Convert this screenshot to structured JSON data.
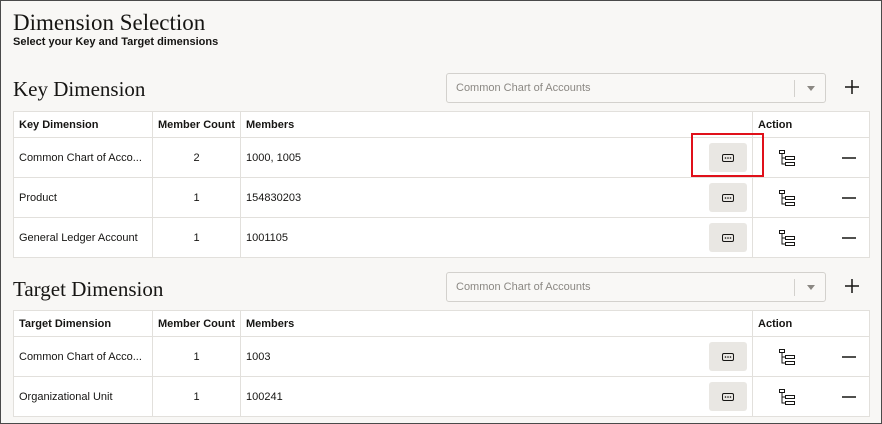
{
  "page": {
    "title": "Dimension Selection",
    "subtitle": "Select your Key and Target dimensions"
  },
  "key_section": {
    "title": "Key Dimension",
    "select_placeholder": "Common Chart of Accounts",
    "columns": [
      "Key Dimension",
      "Member Count",
      "Members",
      "Action"
    ],
    "rows": [
      {
        "name": "Common Chart of Accounts",
        "display_name": "Common Chart of Acco...",
        "count": "2",
        "members": "1000, 1005"
      },
      {
        "name": "Product",
        "display_name": "Product",
        "count": "1",
        "members": "154830203"
      },
      {
        "name": "General Ledger Account",
        "display_name": "General Ledger Account",
        "count": "1",
        "members": "1001105"
      }
    ]
  },
  "target_section": {
    "title": "Target Dimension",
    "select_placeholder": "Common Chart of Accounts",
    "columns": [
      "Target Dimension",
      "Member Count",
      "Members",
      "Action"
    ],
    "rows": [
      {
        "name": "Common Chart of Accounts",
        "display_name": "Common Chart of Acco...",
        "count": "1",
        "members": "1003"
      },
      {
        "name": "Organizational Unit",
        "display_name": "Organizational Unit",
        "count": "1",
        "members": "100241"
      }
    ]
  },
  "icons": {
    "add": "plus-icon",
    "more": "ellipsis-icon",
    "hierarchy": "hierarchy-icon",
    "remove": "minus-icon",
    "dropdown": "chevron-down-icon"
  },
  "colors": {
    "highlight": "#e0101a",
    "background": "#f8f7f5"
  }
}
